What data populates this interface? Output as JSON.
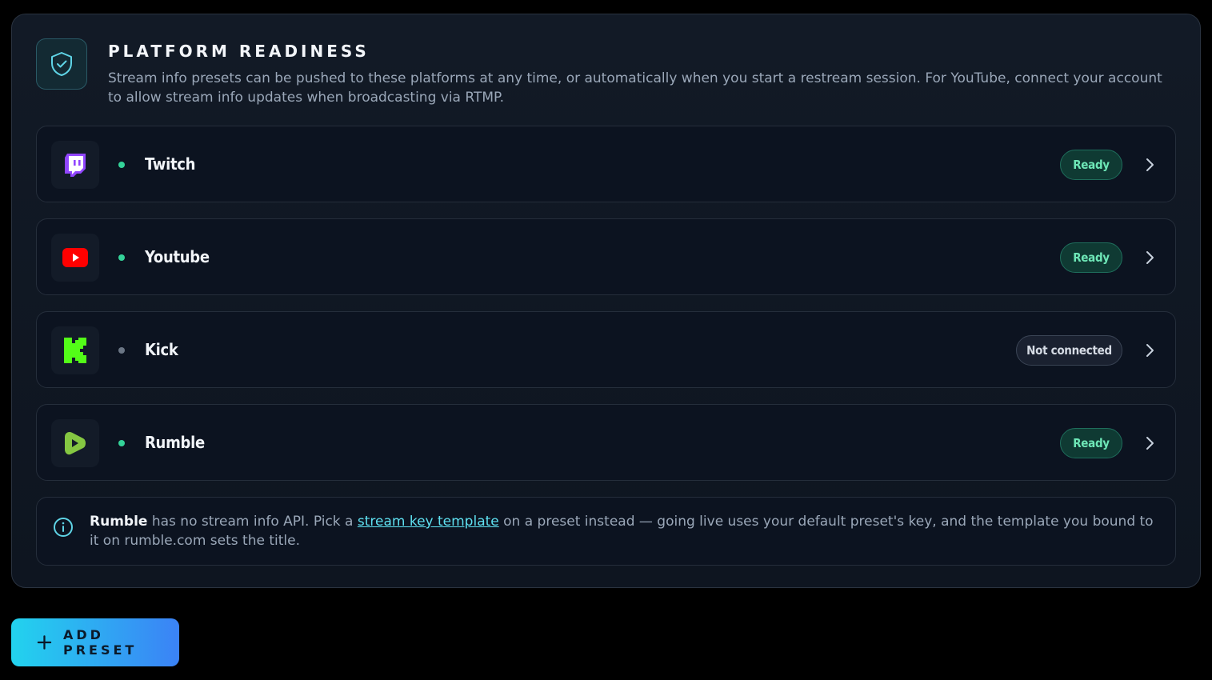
{
  "header": {
    "title": "PLATFORM READINESS",
    "description": "Stream info presets can be pushed to these platforms at any time, or automatically when you start a restream session. For YouTube, connect your account to allow stream info updates when broadcasting via RTMP."
  },
  "platforms": [
    {
      "name": "Twitch",
      "status": "Ready",
      "icon": "twitch-icon",
      "color": "#9146ff"
    },
    {
      "name": "Youtube",
      "status": "Ready",
      "icon": "youtube-icon",
      "color": "#ff0000"
    },
    {
      "name": "Kick",
      "status": "Not connected",
      "icon": "kick-icon",
      "color": "#53fc18"
    },
    {
      "name": "Rumble",
      "status": "Ready",
      "icon": "rumble-icon",
      "color": "#85c742"
    }
  ],
  "info": {
    "strong": "Rumble",
    "before_link": " has no stream info API. Pick a ",
    "link": "stream key template",
    "after_link": " on a preset instead — going live uses your default preset's key, and the template you bound to it on rumble.com sets the title."
  },
  "actions": {
    "add_preset": "ADD PRESET"
  },
  "colors": {
    "ready_text": "#6ee7b7",
    "accent_start": "#22d3ee",
    "accent_end": "#3b82f6"
  }
}
